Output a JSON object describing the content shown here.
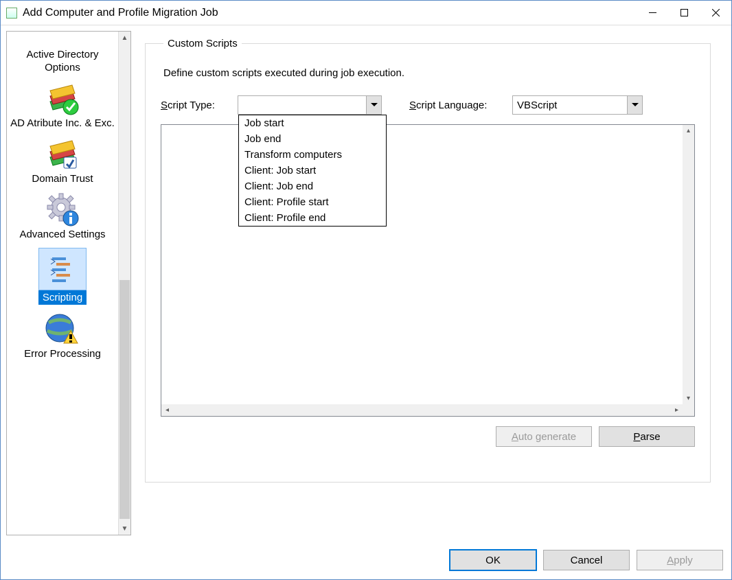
{
  "window": {
    "title": "Add Computer and Profile Migration Job"
  },
  "sidebar": {
    "items": [
      {
        "label": "Active Directory Options",
        "icon": "ad-options-icon",
        "partial": true
      },
      {
        "label": "AD Atribute Inc. & Exc.",
        "icon": "books-check-icon"
      },
      {
        "label": "Domain Trust",
        "icon": "books-shield-icon"
      },
      {
        "label": "Advanced Settings",
        "icon": "gear-info-icon"
      },
      {
        "label": "Scripting",
        "icon": "script-icon",
        "selected": true
      },
      {
        "label": "Error Processing",
        "icon": "globe-warning-icon"
      }
    ]
  },
  "panel": {
    "legend": "Custom Scripts",
    "description": "Define custom scripts executed during job execution.",
    "script_type_label": "Script Type:",
    "script_type_value": "",
    "script_type_options": [
      "Job start",
      "Job end",
      "Transform computers",
      "Client: Job start",
      "Client: Job end",
      "Client: Profile start",
      "Client: Profile end"
    ],
    "script_language_label": "Script Language:",
    "script_language_value": "VBScript",
    "auto_generate_label": "Auto generate",
    "parse_label": "Parse"
  },
  "footer": {
    "ok": "OK",
    "cancel": "Cancel",
    "apply": "Apply"
  }
}
